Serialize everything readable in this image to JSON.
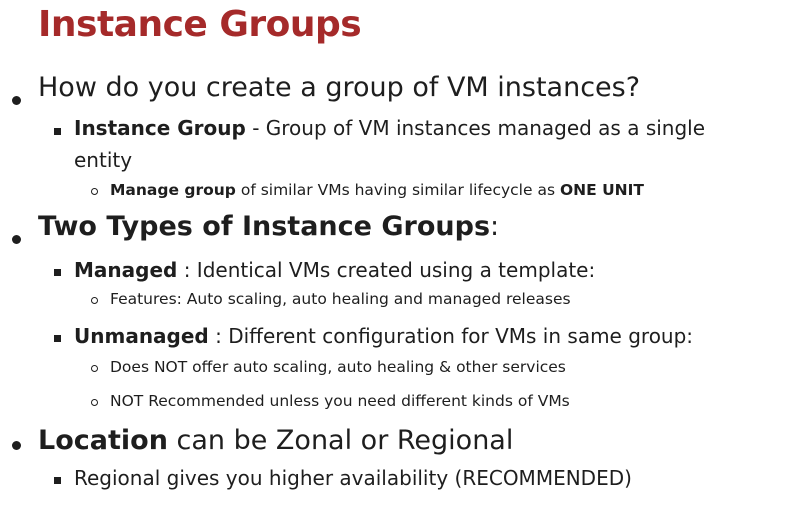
{
  "title": "Instance Groups",
  "bullets": {
    "q1": "How do you create a group of VM instances?",
    "ig_bold": "Instance Group",
    "ig_rest": " - Group of VM instances managed as a single",
    "ig_cont": "entity",
    "mg_bold": "Manage group",
    "mg_mid": " of similar VMs having similar lifecycle as ",
    "mg_bold2": "ONE UNIT",
    "types_bold": "Two Types of Instance Groups",
    "types_rest": ":",
    "managed_bold": "Managed",
    "managed_rest": " : Identical VMs created using a template:",
    "features": "Features: Auto scaling, auto healing and managed releases",
    "unmanaged_bold": "Unmanaged",
    "unmanaged_rest": " : Different configuration for VMs in same group:",
    "notoffer": "Does NOT offer auto scaling, auto healing & other services",
    "notrec": "NOT Recommended unless you need different kinds of VMs",
    "loc_bold": "Location",
    "loc_rest": " can be Zonal or Regional",
    "regional": "Regional gives you higher availability (RECOMMENDED)"
  }
}
